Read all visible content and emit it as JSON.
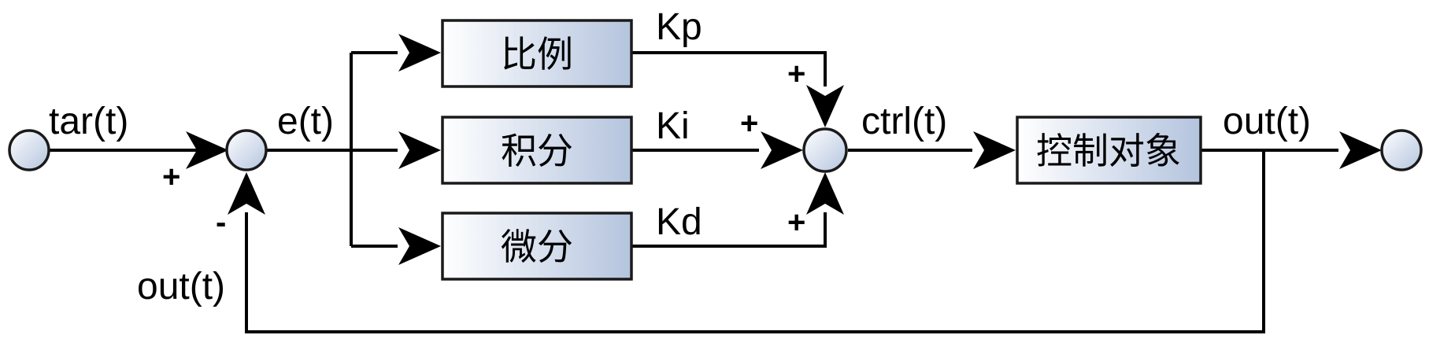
{
  "signals": {
    "target": "tar(t)",
    "error": "e(t)",
    "control": "ctrl(t)",
    "output": "out(t)",
    "feedback": "out(t)"
  },
  "blocks": {
    "proportional": "比例",
    "integral": "积分",
    "derivative": "微分",
    "plant": "控制对象"
  },
  "gains": {
    "kp": "Kp",
    "ki": "Ki",
    "kd": "Kd"
  },
  "signs": {
    "input_plus": "+",
    "feedback_minus": "-",
    "sum_p_plus": "+",
    "sum_i_plus": "+",
    "sum_d_plus": "+"
  },
  "colors": {
    "fill_light": "#ffffff",
    "fill_dark": "#b4c4de",
    "stroke": "#000000"
  }
}
